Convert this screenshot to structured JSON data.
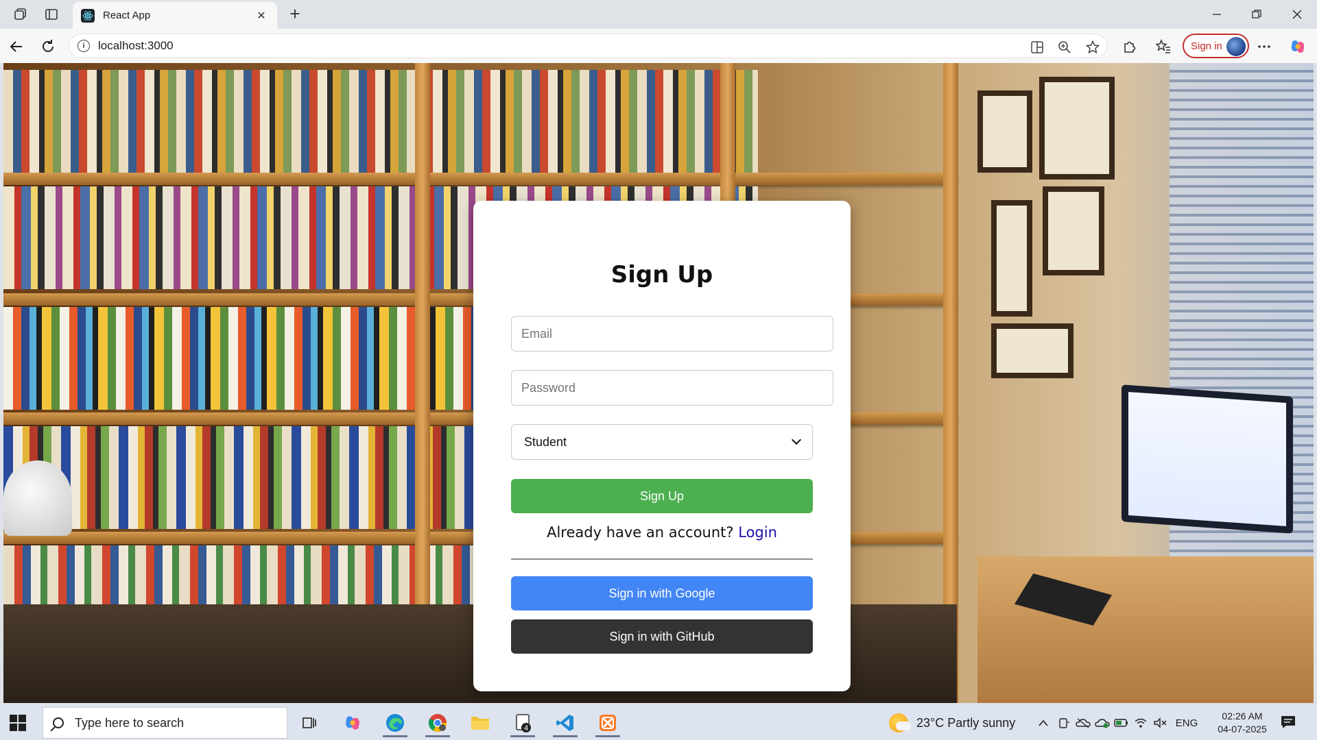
{
  "browser": {
    "tab_title": "React App",
    "url": "localhost:3000",
    "signin_label": "Sign in"
  },
  "signup": {
    "title": "Sign Up",
    "email_placeholder": "Email",
    "password_placeholder": "Password",
    "role_selected": "Student",
    "submit_label": "Sign Up",
    "login_prompt": "Already have an account?",
    "login_link": "Login",
    "google_label": "Sign in with Google",
    "github_label": "Sign in with GitHub"
  },
  "taskbar": {
    "search_placeholder": "Type here to search",
    "weather": "23°C  Partly sunny",
    "language": "ENG",
    "time": "02:26 AM",
    "date": "04-07-2025",
    "explorer_badge": "4"
  },
  "colors": {
    "signup_button": "#4caf50",
    "google_button": "#4285f4",
    "github_button": "#333333",
    "login_link": "#1a0dab"
  },
  "icons": [
    "workspaces-icon",
    "tab-actions-icon",
    "react-favicon-icon",
    "close-tab-icon",
    "new-tab-icon",
    "minimize-icon",
    "maximize-icon",
    "close-window-icon",
    "back-icon",
    "refresh-icon",
    "site-info-icon",
    "split-screen-icon",
    "zoom-icon",
    "favorite-star-icon",
    "extensions-icon",
    "favorites-icon",
    "more-icon",
    "copilot-icon",
    "windows-start-icon",
    "search-icon",
    "task-view-icon",
    "copilot-taskbar-icon",
    "edge-icon",
    "chrome-icon",
    "file-explorer-icon",
    "notepad-icon",
    "vscode-icon",
    "xampp-icon",
    "weather-icon",
    "notification-icon"
  ]
}
